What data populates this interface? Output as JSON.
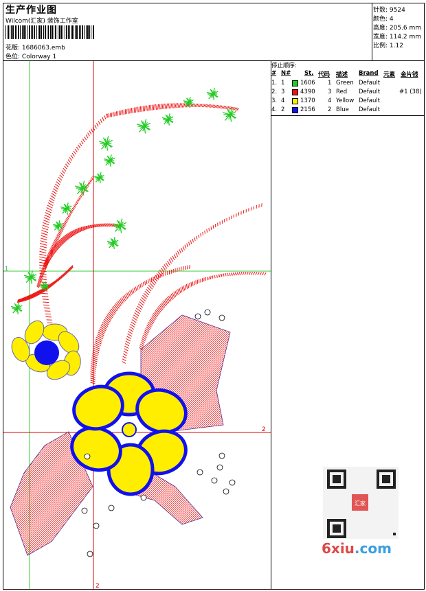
{
  "header": {
    "title": "生产作业图",
    "studio": "Wilcom(汇家) 装饰工作室",
    "design_label": "花版:",
    "design_value": "1686063.emb",
    "colorway_label": "色位:",
    "colorway_value": "Colorway 1"
  },
  "stats": {
    "stitches": "针数: 9524",
    "colors": "颜色: 4",
    "height": "高度: 205.6 mm",
    "width": "宽度: 114.2 mm",
    "scale": "比例: 1.12"
  },
  "legend": {
    "title": "停止顺序:",
    "headers": [
      "#",
      "N#",
      "St.",
      "代码",
      "描述",
      "Brand",
      "元素",
      "金片钱"
    ],
    "rows": [
      {
        "no": "1.",
        "n": "1",
        "st": "1606",
        "code": "1",
        "desc": "Green",
        "brand": "Default",
        "element": "",
        "color": "#22cc22"
      },
      {
        "no": "2.",
        "n": "3",
        "st": "4390",
        "code": "3",
        "desc": "Red",
        "brand": "Default",
        "element": "#1 (38)",
        "color": "#ee1111"
      },
      {
        "no": "3.",
        "n": "4",
        "st": "1370",
        "code": "4",
        "desc": "Yellow",
        "brand": "Default",
        "element": "",
        "color": "#ffee00"
      },
      {
        "no": "4.",
        "n": "2",
        "st": "2156",
        "code": "2",
        "desc": "Blue",
        "brand": "Default",
        "element": "",
        "color": "#1111ee"
      }
    ]
  },
  "guides": {
    "v1": "1",
    "h1": "1",
    "h2": "2",
    "v2": "2"
  },
  "watermark": {
    "text_main": "6xiu",
    "text_dot": ".com",
    "seal": "汇家"
  },
  "colors": {
    "green": "#22cc22",
    "red": "#ee1111",
    "yellow": "#ffee00",
    "blue": "#1111ee",
    "guide_red": "#dd0000",
    "guide_green": "#33cc33"
  }
}
